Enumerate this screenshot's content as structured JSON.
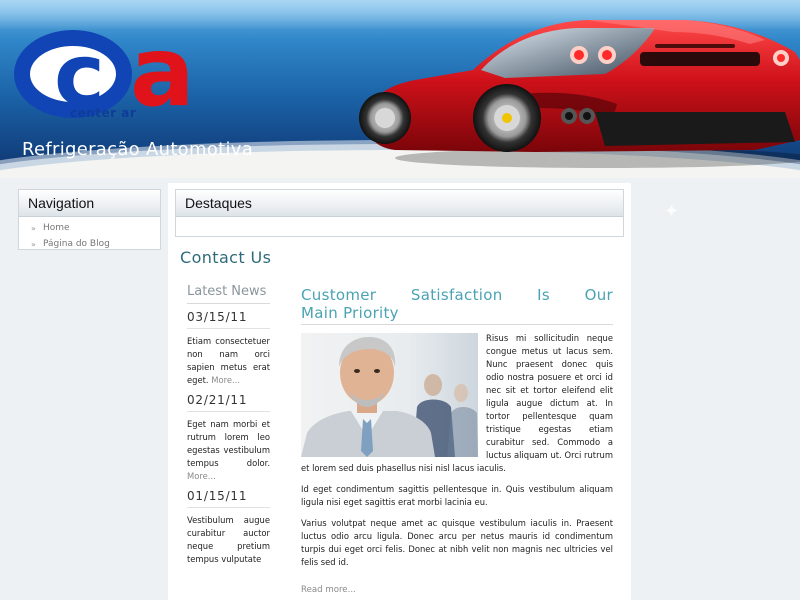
{
  "header": {
    "logo_letter_c": "c",
    "logo_letter_a": "a",
    "logo_word": "center ar",
    "site_title": "Refrigeração Automotiva"
  },
  "sidebar": {
    "title": "Navigation",
    "items": [
      {
        "label": "Home"
      },
      {
        "label": "Página do Blog"
      }
    ]
  },
  "destaques": {
    "title": "Destaques"
  },
  "page": {
    "title": "Contact Us"
  },
  "news": {
    "title": "Latest News",
    "items": [
      {
        "date": "03/15/11",
        "text": "Etiam consectetuer non nam orci sapien metus erat eget.",
        "more": "More..."
      },
      {
        "date": "02/21/11",
        "text": "Eget nam morbi et rutrum lorem leo egestas vestibulum tempus dolor.",
        "more": "More..."
      },
      {
        "date": "01/15/11",
        "text": "Vestibulum augue curabitur auctor neque pretium tempus vulputate",
        "more": ""
      }
    ]
  },
  "article": {
    "title_line1": "Customer Satisfaction Is Our",
    "title_line2": "Main Priority",
    "paragraphs": [
      "Risus mi sollicitudin neque congue metus ut lacus sem. Nunc praesent donec quis odio nostra posuere et orci id nec sit et tortor eleifend elit ligula augue dictum at. In tortor pellentesque quam tristique egestas etiam curabitur sed. Commodo a luctus aliquam ut. Orci rutrum et lorem sed duis phasellus nisi nisl lacus iaculis.",
      "Id eget condimentum sagittis pellentesque in. Quis vestibulum aliquam ligula nisi eget sagittis erat morbi lacinia eu.",
      "Varius volutpat neque amet ac quisque vestibulum iaculis in. Praesent luctus odio arcu ligula. Donec arcu per netus mauris id condimentum turpis dui eget orci felis. Donec at nibh velit non magnis nec ultricies vel felis sed id."
    ],
    "read_more": "Read more..."
  },
  "colors": {
    "header_blue": "#1a5fa4",
    "logo_blue": "#1144b4",
    "logo_red": "#e0131b",
    "article_title": "#4aa3b3",
    "page_title": "#2e6b7a"
  },
  "icons": {
    "nav_bullet": "double-arrow-right-icon"
  }
}
